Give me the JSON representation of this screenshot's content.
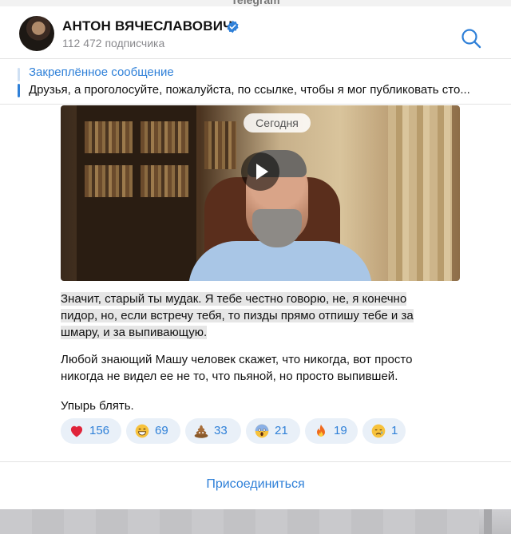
{
  "app": {
    "title": "Telegram"
  },
  "channel": {
    "name": "АНТОН ВЯЧЕСЛАВОВИЧ",
    "subscribers": "112 472 подписчика",
    "verified_icon": "verified-badge-icon",
    "search_icon": "search-icon"
  },
  "pinned": {
    "title": "Закреплённое сообщение",
    "text": "Друзья, а проголосуйте, пожалуйста, по ссылке, чтобы я мог публиковать сто..."
  },
  "message": {
    "date_label": "Сегодня",
    "play_icon": "play-icon",
    "paragraph1_line1": "Значит, старый ты мудак. Я тебе честно говорю, не, я конечно",
    "paragraph1_line2": "пидор, но, если встречу тебя, то пизды прямо отпишу тебе и за",
    "paragraph1_line3": "шмару, и за выпивающую.",
    "paragraph2_line1": "Любой знающий Машу человек скажет, что никогда, вот просто",
    "paragraph2_line2": "никогда не видел ее не то, что пьяной, но просто выпившей.",
    "paragraph3": "Упырь блять."
  },
  "reactions": [
    {
      "emoji": "heart-icon",
      "count": "156"
    },
    {
      "emoji": "grinning-face-icon",
      "count": "69"
    },
    {
      "emoji": "poop-icon",
      "count": "33"
    },
    {
      "emoji": "screaming-face-icon",
      "count": "21"
    },
    {
      "emoji": "fire-icon",
      "count": "19"
    },
    {
      "emoji": "crying-face-icon",
      "count": "1"
    }
  ],
  "footer": {
    "join_label": "Присоединиться"
  },
  "colors": {
    "accent": "#2f80d8",
    "reaction_bg": "#e9f0f8",
    "heart": "#e0243a"
  }
}
